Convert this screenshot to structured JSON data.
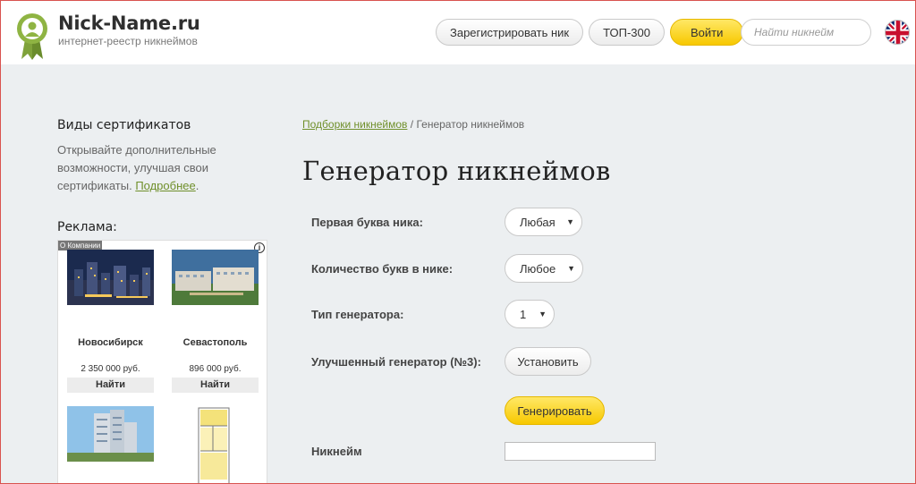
{
  "header": {
    "logo_title": "Nick-Name.ru",
    "logo_subtitle": "интернет-реестр никнеймов",
    "nav": {
      "register": "Зарегистрировать ник",
      "top300": "ТОП-300",
      "login": "Войти"
    },
    "search_placeholder": "Найти никнейм",
    "language_icon": "uk-flag-icon"
  },
  "sidebar": {
    "cert_title": "Виды сертификатов",
    "cert_text": "Открывайте дополнительные возможности, улучшая свои сертификаты.",
    "cert_link": "Подробнее",
    "cert_link_suffix": ".",
    "ads_title": "Реклама:",
    "ad_tag": "О Компании",
    "ad_info": "i",
    "ads": [
      {
        "city": "Новосибирск",
        "price": "2 350 000 руб.",
        "button": "Найти"
      },
      {
        "city": "Севастополь",
        "price": "896 000 руб.",
        "button": "Найти"
      }
    ]
  },
  "main": {
    "breadcrumb_link": "Подборки никнеймов",
    "breadcrumb_sep": " / ",
    "breadcrumb_current": "Генератор никнеймов",
    "title": "Генератор никнеймов",
    "form": {
      "first_letter_label": "Первая буква ника:",
      "first_letter_value": "Любая",
      "letter_count_label": "Количество букв в нике:",
      "letter_count_value": "Любое",
      "generator_type_label": "Тип генератора:",
      "generator_type_value": "1",
      "improved_label": "Улучшенный генератор (№3):",
      "install_button": "Установить",
      "generate_button": "Генерировать",
      "nickname_label": "Никнейм",
      "nickname_value": ""
    }
  },
  "colors": {
    "accent_yellow": "#f7c800",
    "link_green": "#6f8f2a",
    "background": "#eceff1"
  }
}
